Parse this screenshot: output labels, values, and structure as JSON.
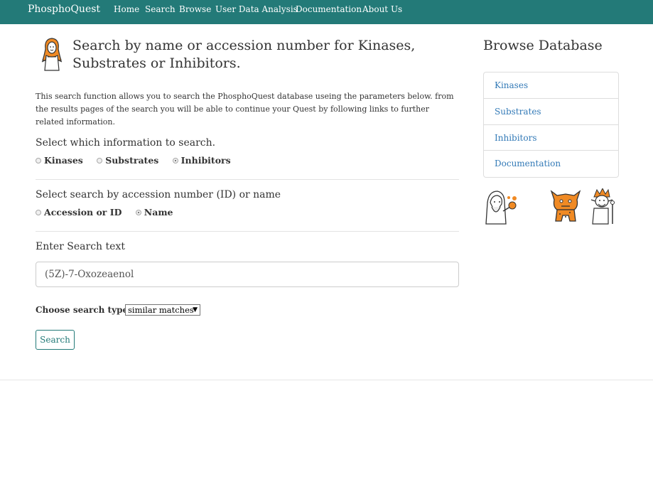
{
  "nav": {
    "brand": "PhosphoQuest",
    "links": [
      "Home",
      "Search",
      "Browse",
      "User Data Analysis",
      "Documentation",
      "About Us"
    ]
  },
  "main": {
    "title": "Search by name or accession number for Kinases, Substrates or Inhibitors.",
    "intro": "This search function allows you to search the PhosphoQuest database useing the parameters below. from the results pages of the search you will be able to continue your Quest by following links to further related information.",
    "info_section": {
      "label": "Select which information to search.",
      "options": [
        "Kinases",
        "Substrates",
        "Inhibitors"
      ],
      "selected": "Inhibitors"
    },
    "by_section": {
      "label": "Select search by accession number (ID) or name",
      "options": [
        "Accession or ID",
        "Name"
      ],
      "selected": "Name"
    },
    "text_section": {
      "label": "Enter Search text",
      "value": "(5Z)-7-Oxozeaenol"
    },
    "search_type": {
      "label": "Choose search type:",
      "selected": "similar matches"
    },
    "search_button": "Search"
  },
  "sidebar": {
    "title": "Browse Database",
    "items": [
      "Kinases",
      "Substrates",
      "Inhibitors",
      "Documentation"
    ]
  },
  "colors": {
    "navbar": "#237a78",
    "link": "#337ab7",
    "accent_orange": "#f08a24"
  }
}
